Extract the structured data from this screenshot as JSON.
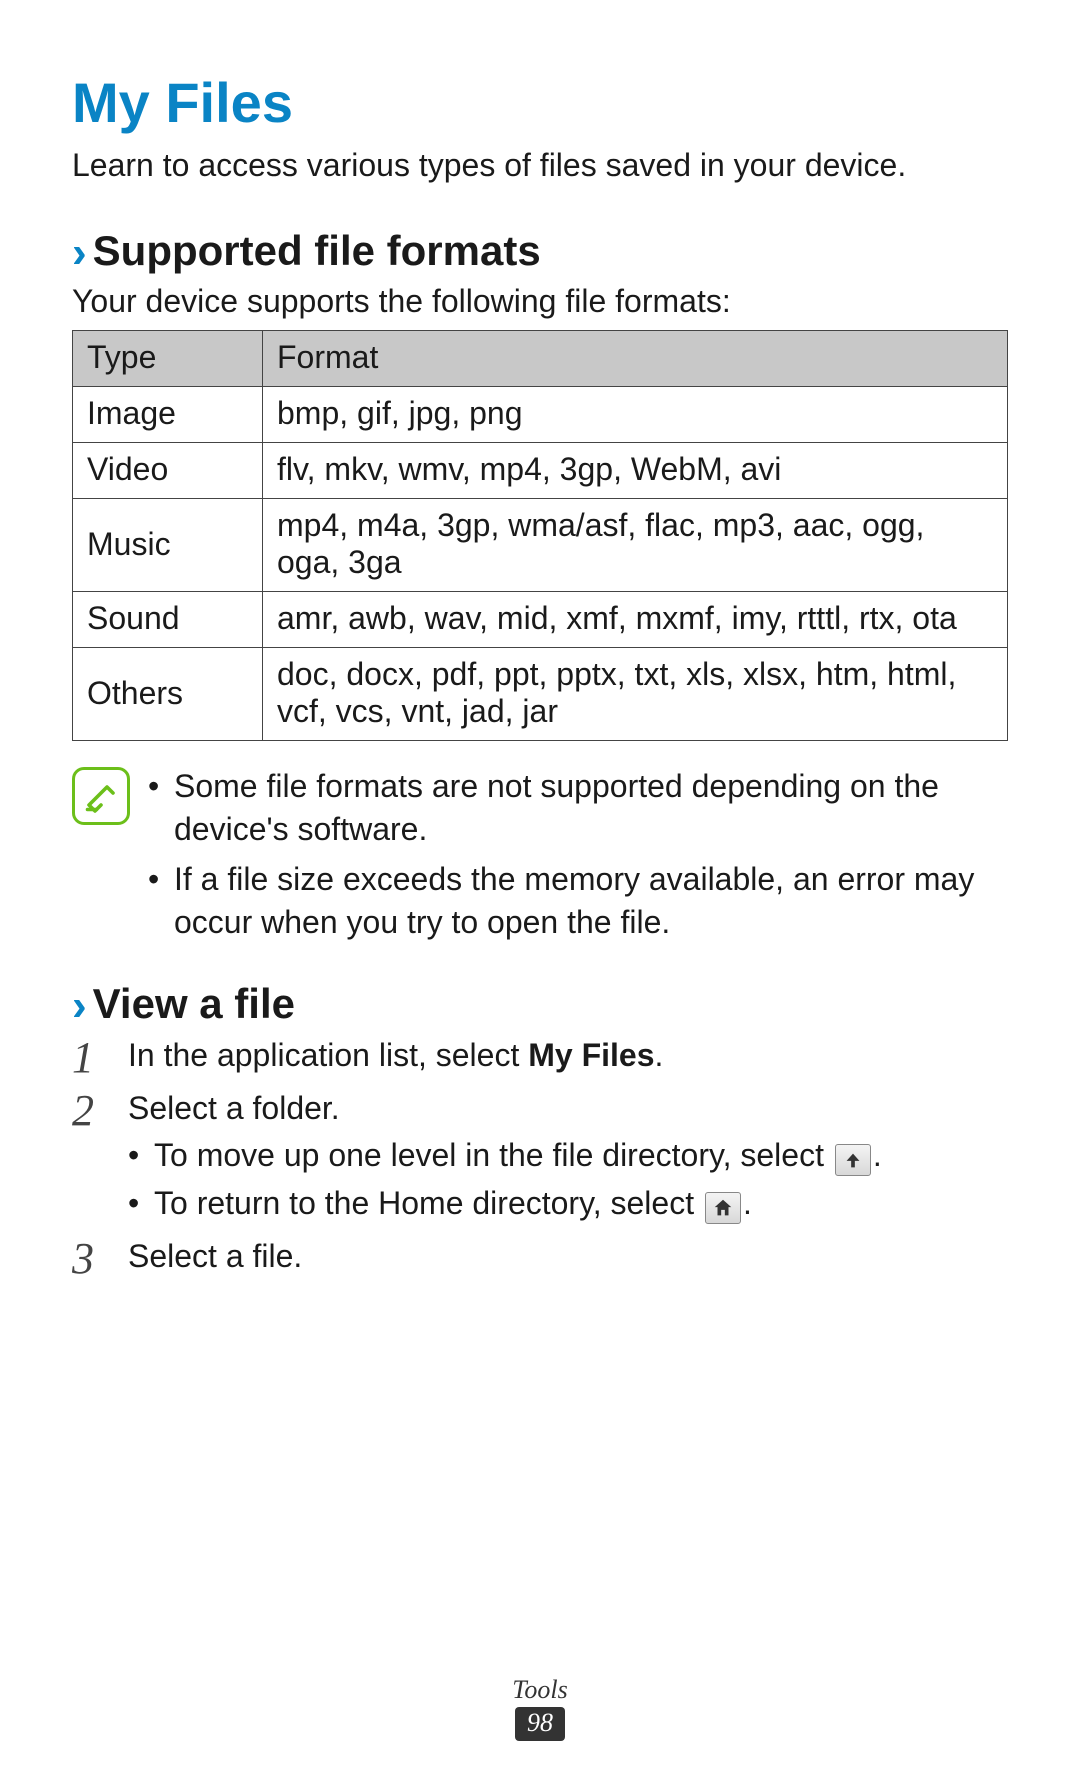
{
  "title": "My Files",
  "intro": "Learn to access various types of files saved in your device.",
  "section_formats": {
    "heading": "Supported file formats",
    "body": "Your device supports the following file formats:",
    "table": {
      "head_type": "Type",
      "head_format": "Format",
      "rows": [
        {
          "type": "Image",
          "format": "bmp, gif, jpg, png"
        },
        {
          "type": "Video",
          "format": "flv, mkv, wmv, mp4, 3gp, WebM, avi"
        },
        {
          "type": "Music",
          "format": "mp4, m4a, 3gp, wma/asf, flac, mp3, aac, ogg, oga, 3ga"
        },
        {
          "type": "Sound",
          "format": "amr, awb, wav, mid, xmf, mxmf, imy, rtttl, rtx, ota"
        },
        {
          "type": "Others",
          "format": "doc, docx, pdf, ppt, pptx, txt, xls, xlsx, htm, html, vcf, vcs, vnt, jad, jar"
        }
      ]
    },
    "notes": [
      "Some file formats are not supported depending on the device's software.",
      "If a file size exceeds the memory available, an error may occur when you try to open the file."
    ]
  },
  "section_view": {
    "heading": "View a file",
    "steps": {
      "s1_pre": "In the application list, select ",
      "s1_bold": "My Files",
      "s1_post": ".",
      "s2": "Select a folder.",
      "s2_sub1_pre": "To move up one level in the file directory, select ",
      "s2_sub1_post": ".",
      "s2_sub2_pre": "To return to the Home directory, select ",
      "s2_sub2_post": ".",
      "s3": "Select a file."
    }
  },
  "footer": {
    "section": "Tools",
    "page": "98"
  }
}
